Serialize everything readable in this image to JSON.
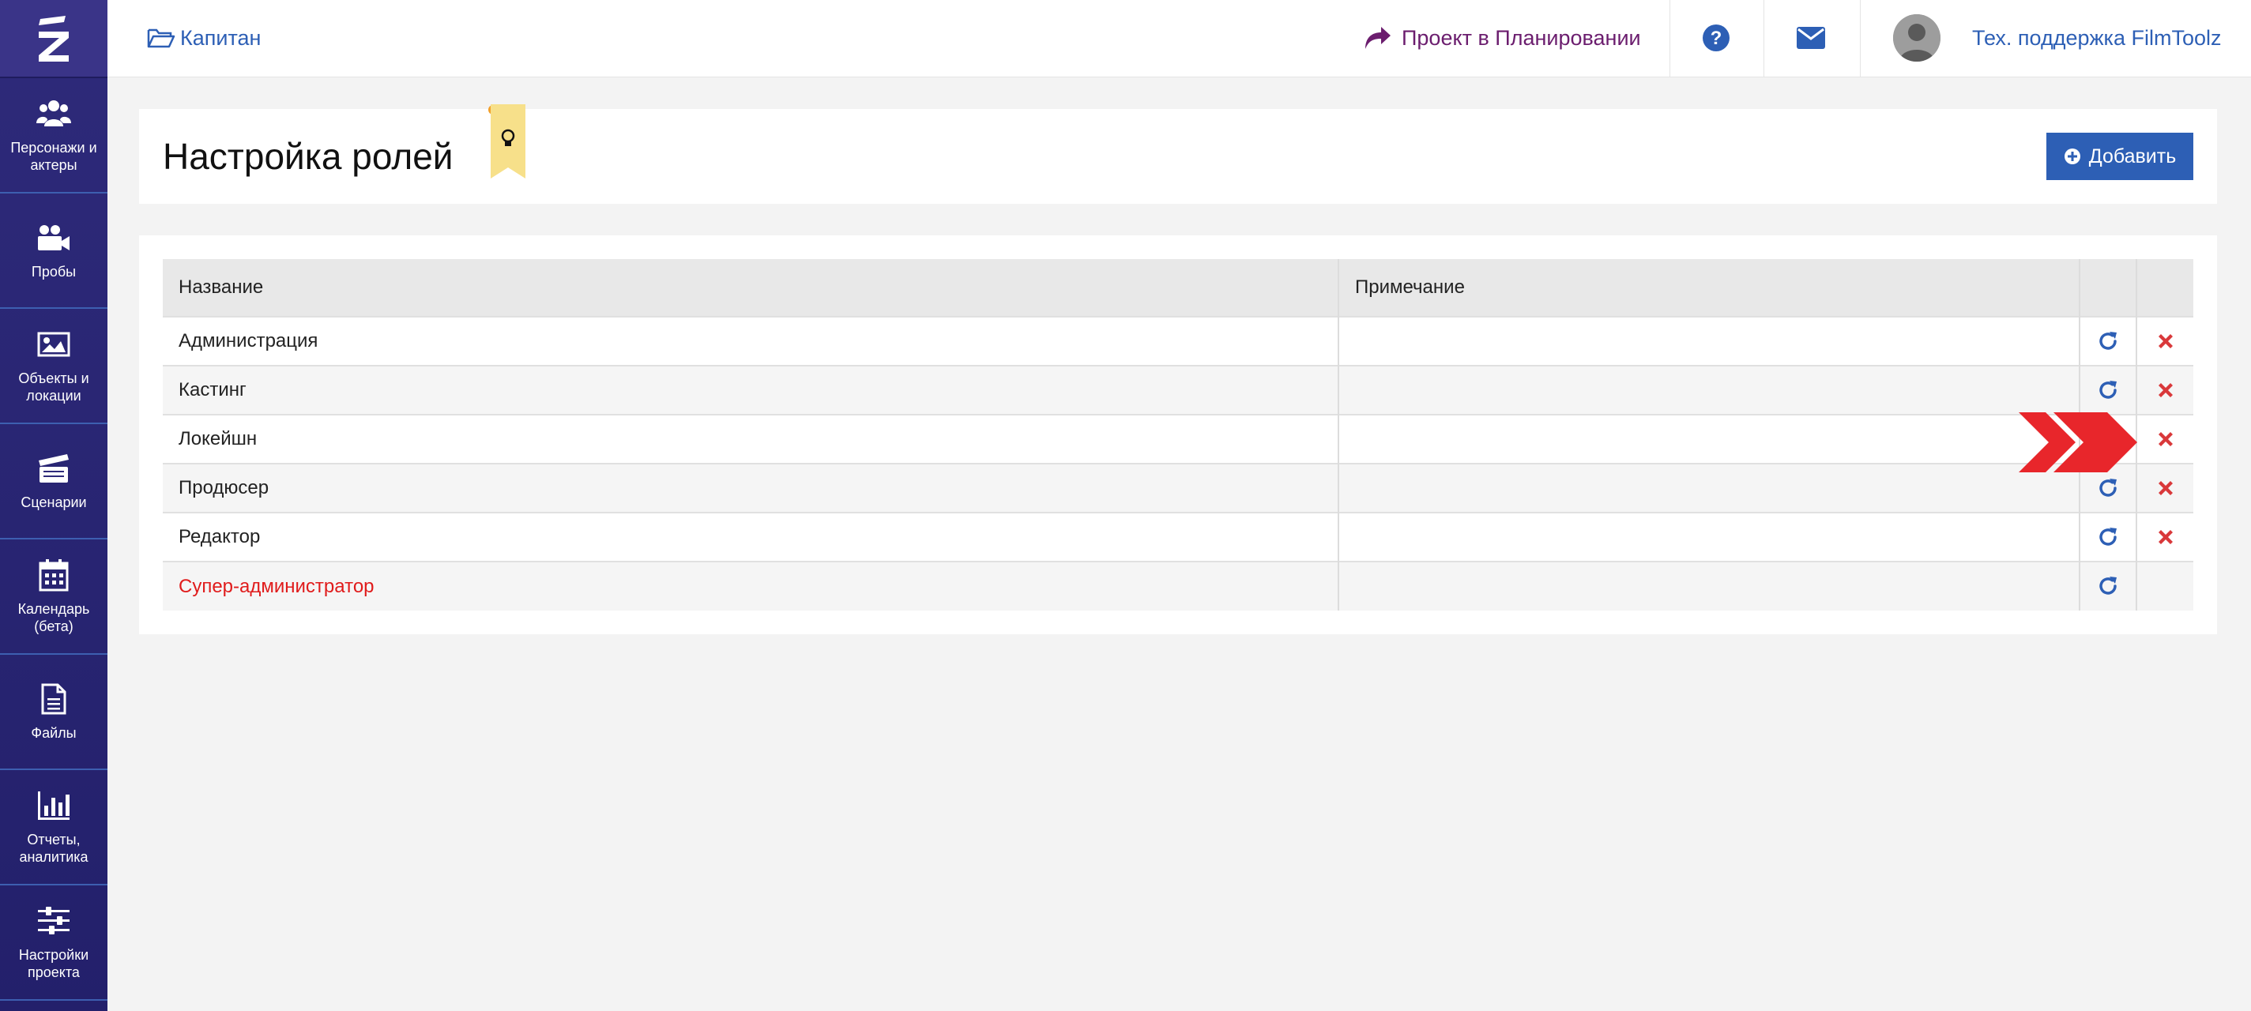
{
  "sidebar": {
    "logo_icon": "z-logo-icon",
    "items": [
      {
        "label": "Персонажи и актеры",
        "icon": "people-icon"
      },
      {
        "label": "Пробы",
        "icon": "video-camera-icon"
      },
      {
        "label": "Объекты и локации",
        "icon": "image-icon"
      },
      {
        "label": "Сценарии",
        "icon": "clapperboard-icon"
      },
      {
        "label": "Календарь (бета)",
        "icon": "calendar-icon"
      },
      {
        "label": "Файлы",
        "icon": "file-icon"
      },
      {
        "label": "Отчеты, аналитика",
        "icon": "bar-chart-icon"
      },
      {
        "label": "Настройки проекта",
        "icon": "sliders-icon"
      }
    ]
  },
  "topbar": {
    "project_name": "Капитан",
    "status": "Проект в Планировании",
    "user_name": "Тех. поддержка FilmToolz"
  },
  "header": {
    "title": "Настройка ролей",
    "add_button": "Добавить"
  },
  "table": {
    "columns": [
      "Название",
      "Примечание",
      "",
      ""
    ],
    "rows": [
      {
        "name": "Администрация",
        "note": "",
        "refresh": true,
        "delete": true
      },
      {
        "name": "Кастинг",
        "note": "",
        "refresh": true,
        "delete": true
      },
      {
        "name": "Локейшн",
        "note": "",
        "refresh": true,
        "delete": true
      },
      {
        "name": "Продюсер",
        "note": "",
        "refresh": true,
        "delete": true
      },
      {
        "name": "Редактор",
        "note": "",
        "refresh": true,
        "delete": true
      },
      {
        "name": "Супер-администратор",
        "note": "",
        "refresh": true,
        "delete": false
      }
    ]
  },
  "colors": {
    "sidebar_bg": "#2e2a7a",
    "accent": "#2d5fb5",
    "status": "#6b1d6e",
    "danger": "#d9383a",
    "highlight_arrow": "#e8262b",
    "super_admin": "#e01b1b",
    "bookmark": "#f7e08a"
  }
}
